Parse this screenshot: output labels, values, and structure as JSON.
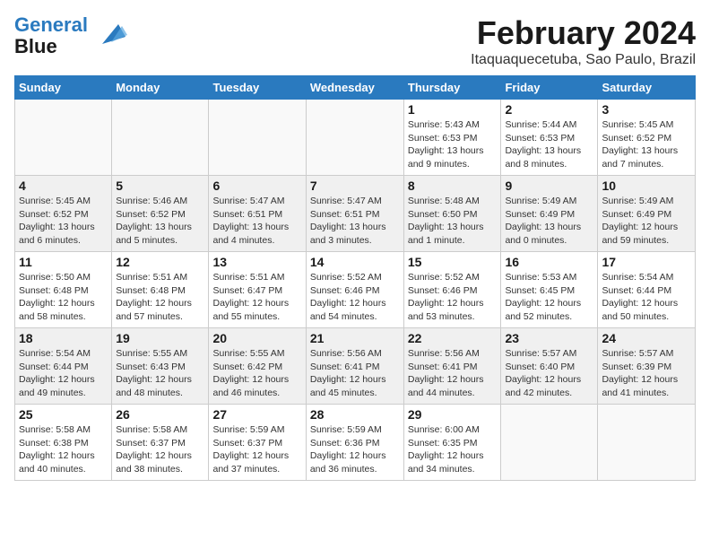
{
  "logo": {
    "line1": "General",
    "line2": "Blue"
  },
  "title": "February 2024",
  "subtitle": "Itaquaquecetuba, Sao Paulo, Brazil",
  "days_of_week": [
    "Sunday",
    "Monday",
    "Tuesday",
    "Wednesday",
    "Thursday",
    "Friday",
    "Saturday"
  ],
  "weeks": [
    [
      {
        "day": "",
        "info": ""
      },
      {
        "day": "",
        "info": ""
      },
      {
        "day": "",
        "info": ""
      },
      {
        "day": "",
        "info": ""
      },
      {
        "day": "1",
        "info": "Sunrise: 5:43 AM\nSunset: 6:53 PM\nDaylight: 13 hours\nand 9 minutes."
      },
      {
        "day": "2",
        "info": "Sunrise: 5:44 AM\nSunset: 6:53 PM\nDaylight: 13 hours\nand 8 minutes."
      },
      {
        "day": "3",
        "info": "Sunrise: 5:45 AM\nSunset: 6:52 PM\nDaylight: 13 hours\nand 7 minutes."
      }
    ],
    [
      {
        "day": "4",
        "info": "Sunrise: 5:45 AM\nSunset: 6:52 PM\nDaylight: 13 hours\nand 6 minutes."
      },
      {
        "day": "5",
        "info": "Sunrise: 5:46 AM\nSunset: 6:52 PM\nDaylight: 13 hours\nand 5 minutes."
      },
      {
        "day": "6",
        "info": "Sunrise: 5:47 AM\nSunset: 6:51 PM\nDaylight: 13 hours\nand 4 minutes."
      },
      {
        "day": "7",
        "info": "Sunrise: 5:47 AM\nSunset: 6:51 PM\nDaylight: 13 hours\nand 3 minutes."
      },
      {
        "day": "8",
        "info": "Sunrise: 5:48 AM\nSunset: 6:50 PM\nDaylight: 13 hours\nand 1 minute."
      },
      {
        "day": "9",
        "info": "Sunrise: 5:49 AM\nSunset: 6:49 PM\nDaylight: 13 hours\nand 0 minutes."
      },
      {
        "day": "10",
        "info": "Sunrise: 5:49 AM\nSunset: 6:49 PM\nDaylight: 12 hours\nand 59 minutes."
      }
    ],
    [
      {
        "day": "11",
        "info": "Sunrise: 5:50 AM\nSunset: 6:48 PM\nDaylight: 12 hours\nand 58 minutes."
      },
      {
        "day": "12",
        "info": "Sunrise: 5:51 AM\nSunset: 6:48 PM\nDaylight: 12 hours\nand 57 minutes."
      },
      {
        "day": "13",
        "info": "Sunrise: 5:51 AM\nSunset: 6:47 PM\nDaylight: 12 hours\nand 55 minutes."
      },
      {
        "day": "14",
        "info": "Sunrise: 5:52 AM\nSunset: 6:46 PM\nDaylight: 12 hours\nand 54 minutes."
      },
      {
        "day": "15",
        "info": "Sunrise: 5:52 AM\nSunset: 6:46 PM\nDaylight: 12 hours\nand 53 minutes."
      },
      {
        "day": "16",
        "info": "Sunrise: 5:53 AM\nSunset: 6:45 PM\nDaylight: 12 hours\nand 52 minutes."
      },
      {
        "day": "17",
        "info": "Sunrise: 5:54 AM\nSunset: 6:44 PM\nDaylight: 12 hours\nand 50 minutes."
      }
    ],
    [
      {
        "day": "18",
        "info": "Sunrise: 5:54 AM\nSunset: 6:44 PM\nDaylight: 12 hours\nand 49 minutes."
      },
      {
        "day": "19",
        "info": "Sunrise: 5:55 AM\nSunset: 6:43 PM\nDaylight: 12 hours\nand 48 minutes."
      },
      {
        "day": "20",
        "info": "Sunrise: 5:55 AM\nSunset: 6:42 PM\nDaylight: 12 hours\nand 46 minutes."
      },
      {
        "day": "21",
        "info": "Sunrise: 5:56 AM\nSunset: 6:41 PM\nDaylight: 12 hours\nand 45 minutes."
      },
      {
        "day": "22",
        "info": "Sunrise: 5:56 AM\nSunset: 6:41 PM\nDaylight: 12 hours\nand 44 minutes."
      },
      {
        "day": "23",
        "info": "Sunrise: 5:57 AM\nSunset: 6:40 PM\nDaylight: 12 hours\nand 42 minutes."
      },
      {
        "day": "24",
        "info": "Sunrise: 5:57 AM\nSunset: 6:39 PM\nDaylight: 12 hours\nand 41 minutes."
      }
    ],
    [
      {
        "day": "25",
        "info": "Sunrise: 5:58 AM\nSunset: 6:38 PM\nDaylight: 12 hours\nand 40 minutes."
      },
      {
        "day": "26",
        "info": "Sunrise: 5:58 AM\nSunset: 6:37 PM\nDaylight: 12 hours\nand 38 minutes."
      },
      {
        "day": "27",
        "info": "Sunrise: 5:59 AM\nSunset: 6:37 PM\nDaylight: 12 hours\nand 37 minutes."
      },
      {
        "day": "28",
        "info": "Sunrise: 5:59 AM\nSunset: 6:36 PM\nDaylight: 12 hours\nand 36 minutes."
      },
      {
        "day": "29",
        "info": "Sunrise: 6:00 AM\nSunset: 6:35 PM\nDaylight: 12 hours\nand 34 minutes."
      },
      {
        "day": "",
        "info": ""
      },
      {
        "day": "",
        "info": ""
      }
    ]
  ]
}
